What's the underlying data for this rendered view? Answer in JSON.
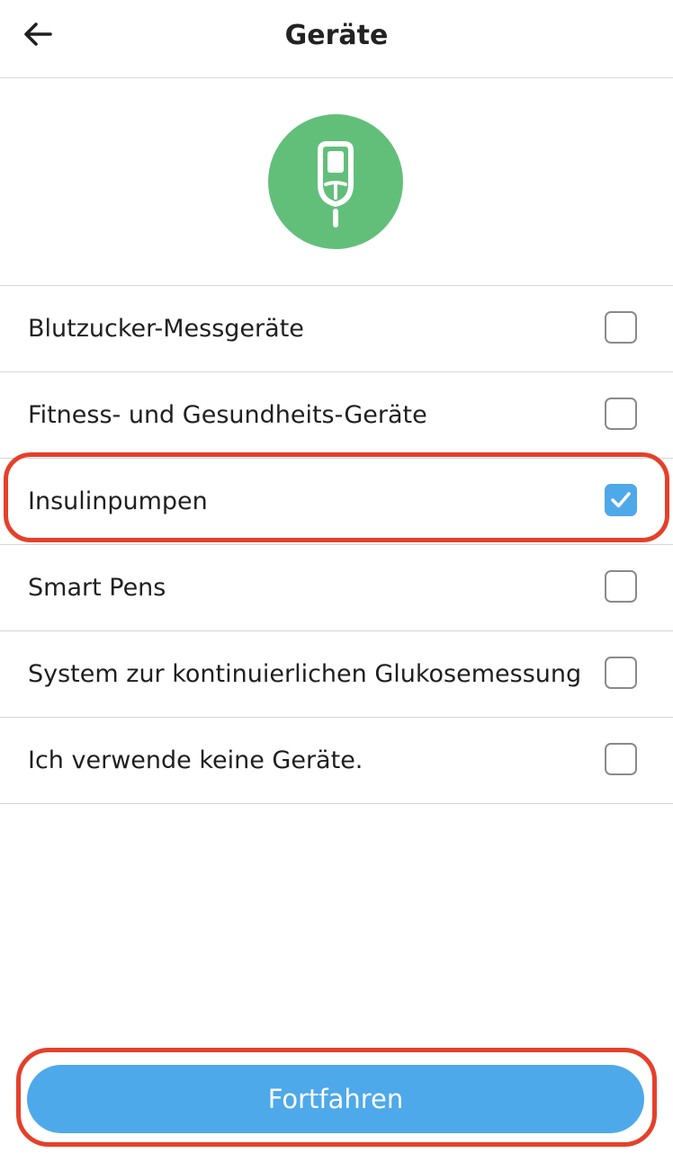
{
  "header": {
    "title": "Geräte",
    "back_icon": "arrow-left-icon"
  },
  "hero": {
    "icon": "glucose-meter-icon",
    "circle_color": "#62bf7a"
  },
  "options": [
    {
      "label": "Blutzucker-Messgeräte",
      "checked": false
    },
    {
      "label": "Fitness- und Gesundheits-Geräte",
      "checked": false
    },
    {
      "label": "Insulinpumpen",
      "checked": true
    },
    {
      "label": "Smart Pens",
      "checked": false
    },
    {
      "label": "System zur kontinuierlichen Glukosemessung",
      "checked": false
    },
    {
      "label": "Ich verwende keine Geräte.",
      "checked": false
    }
  ],
  "footer": {
    "continue_label": "Fortfahren"
  },
  "colors": {
    "accent": "#4ea9ea",
    "highlight": "#e5402a",
    "divider": "#d6d6d6"
  }
}
